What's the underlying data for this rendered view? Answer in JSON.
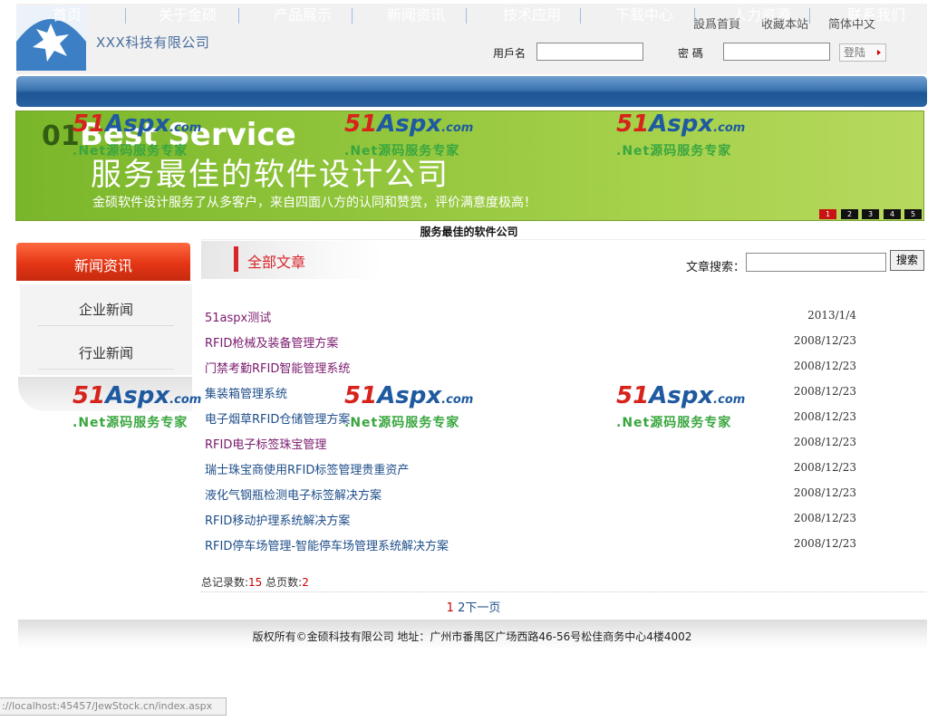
{
  "header": {
    "company_name": "XXX科技有限公司",
    "links": [
      "設爲首頁",
      "收藏本站",
      "简体中文"
    ],
    "username_label": "用戶名",
    "password_label": "密 碼",
    "login_label": "登陆"
  },
  "nav": [
    "首页",
    "关于金硕",
    "产品展示",
    "新闻资讯",
    "技术应用",
    "下载中心",
    "人力资源",
    "联系我们"
  ],
  "banner": {
    "number": "01",
    "english": "Best Service",
    "headline": "服务最佳的软件设计公司",
    "tagline": "金硕软件设计服务了从多客户，来自四面八方的认同和赞赏，评价满意度极高！",
    "pages": [
      "1",
      "2",
      "3",
      "4",
      "5"
    ],
    "active_page": "1",
    "caption": "服务最佳的软件公司"
  },
  "sidebar": {
    "title": "新闻资讯",
    "items": [
      "企业新闻",
      "行业新闻"
    ]
  },
  "content": {
    "tab_title": "全部文章",
    "search_label": "文章搜索：",
    "search_button": "搜索",
    "articles": [
      {
        "title": "51aspx测试",
        "date": "2013/1/4"
      },
      {
        "title": "RFID枪械及装备管理方案",
        "date": "2008/12/23"
      },
      {
        "title": "门禁考勤RFID智能管理系统",
        "date": "2008/12/23"
      },
      {
        "title": "集装箱管理系统",
        "date": "2008/12/23"
      },
      {
        "title": "电子烟草RFID仓储管理方案",
        "date": "2008/12/23"
      },
      {
        "title": "RFID电子标签珠宝管理",
        "date": "2008/12/23"
      },
      {
        "title": "瑞士珠宝商使用RFID标签管理贵重资产",
        "date": "2008/12/23"
      },
      {
        "title": "液化气钢瓶检测电子标签解决方案",
        "date": "2008/12/23"
      },
      {
        "title": "RFID移动护理系统解决方案",
        "date": "2008/12/23"
      },
      {
        "title": "RFID停车场管理-智能停车场管理系统解决方案",
        "date": "2008/12/23"
      }
    ],
    "records_label": "总记录数:",
    "records_value": "15",
    "pages_label": "总页数:",
    "pages_value": "2",
    "pager_current": "1",
    "pager_page2": "2",
    "pager_next": "下一页"
  },
  "footer": {
    "text": "版权所有©金硕科技有限公司  地址：广州市番禺区广场西路46-56号松佳商务中心4楼4002"
  },
  "statusbar": {
    "url": "://localhost:45457/JewStock.cn/index.aspx"
  },
  "watermark": {
    "brand_red": "51",
    "brand_blue": "Aspx",
    "brand_suffix": ".com",
    "slogan": ".Net源码服务专家"
  },
  "colors": {
    "nav_blue": "#2a62a2",
    "accent_red": "#d7262c",
    "banner_green": "#8fc43a",
    "link_purple": "#7a1a6e",
    "link_blue": "#1e4e8a"
  }
}
